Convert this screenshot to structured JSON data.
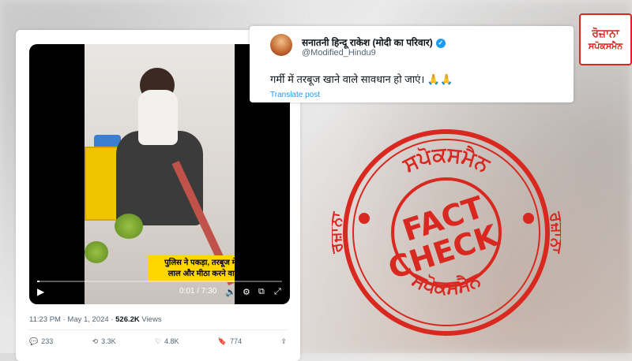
{
  "tweet": {
    "video": {
      "caption_line1": "पुलिस ने पकड़ा, तरबूज में लगा रहा था",
      "caption_line2": "लाल और मीठा करने वाला इंजेक्शन",
      "time": "0:01 / 7:30",
      "progress_fraction": 0.002
    },
    "meta": {
      "time": "11:23 PM · May 1, 2024 · ",
      "views_count": "526.2K",
      "views_label": " Views"
    },
    "actions": {
      "replies": "233",
      "reposts": "3.3K",
      "likes": "4.8K",
      "bookmarks": "774"
    }
  },
  "quote": {
    "name": "सनातनी हिन्दू राकेश (मोदी का परिवार)",
    "handle": "@Modified_Hindu9",
    "text": "गर्मी में तरबूज खाने वाले सावधान हो जाएं। 🙏🙏",
    "translate": "Translate post"
  },
  "logo": {
    "line1": "ਰੋਜ਼ਾਨਾ",
    "line2": "ਸਪੋਕਸਮੈਨ"
  },
  "stamp": {
    "top_text": "ਸਪੋਕਸਮੈਨ",
    "left_text": "ਰੋਜ਼ਾਨਾ",
    "right_text": "ਰੋਜ਼ਾਨਾ",
    "bottom_text": "ਸਪੋਕਸਮੈਨ",
    "word1": "FACT",
    "word2": "CHECK",
    "color": "#d9281f"
  },
  "colors": {
    "accent": "#1d9bf0",
    "caption_bg": "#ffd600",
    "stamp": "#d9281f"
  }
}
